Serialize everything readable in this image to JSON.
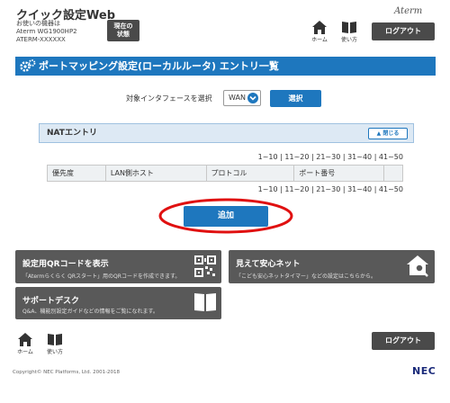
{
  "header": {
    "app_title": "クイック設定Web",
    "device_line1": "お使いの機器は",
    "device_line2": "Aterm WG1900HP2",
    "device_line3": "ATERM-XXXXXX",
    "status_button_line1": "現在の",
    "status_button_line2": "状態",
    "brand": "Aterm",
    "home_label": "ホーム",
    "howto_label": "使い方",
    "logout_label": "ログアウト"
  },
  "page": {
    "title": "ポートマッピング設定(ローカルルータ) エントリ一覧",
    "interface_label": "対象インタフェースを選択",
    "interface_value": "WAN",
    "select_button": "選択"
  },
  "nat_section": {
    "title": "NATエントリ",
    "collapse_label": "閉じる",
    "pager": "1~10 | 11~20 | 21~30 | 31~40 | 41~50",
    "columns": [
      "優先度",
      "LAN側ホスト",
      "プロトコル",
      "ポート番号"
    ],
    "add_button": "追加"
  },
  "cards": {
    "qr": {
      "title": "設定用QRコードを表示",
      "desc": "「Atermらくらく QRスタート」用のQRコードを作成できます。"
    },
    "safety": {
      "title": "見えて安心ネット",
      "desc": "「こども安心ネットタイマー」などの設定はこちらから。"
    },
    "support": {
      "title": "サポートデスク",
      "desc": "Q&A、機能別設定ガイドなどの情報をご覧になれます。"
    }
  },
  "footer": {
    "home_label": "ホーム",
    "howto_label": "使い方",
    "logout_label": "ログアウト",
    "copyright": "Copyright© NEC Platforms, Ltd. 2001-2018",
    "brand": "NEC"
  },
  "colors": {
    "accent_blue": "#1e77be",
    "dark_button": "#4a4a4a",
    "card_gray": "#595959",
    "highlight_red": "#e01010"
  }
}
